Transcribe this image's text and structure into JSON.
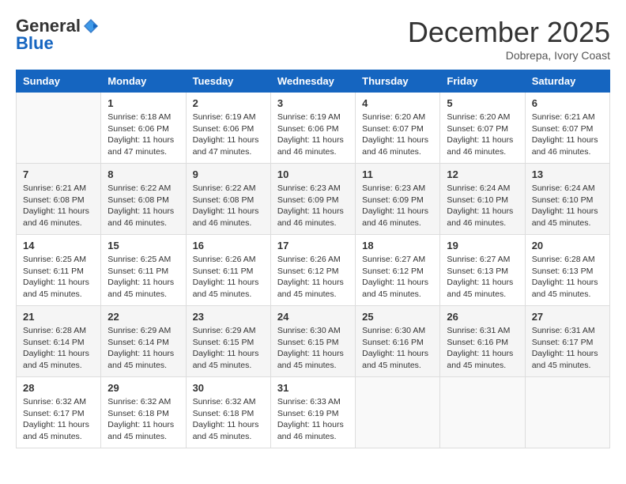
{
  "header": {
    "logo_general": "General",
    "logo_blue": "Blue",
    "month_title": "December 2025",
    "location": "Dobrepa, Ivory Coast"
  },
  "days_of_week": [
    "Sunday",
    "Monday",
    "Tuesday",
    "Wednesday",
    "Thursday",
    "Friday",
    "Saturday"
  ],
  "weeks": [
    [
      {
        "day": "",
        "info": ""
      },
      {
        "day": "1",
        "info": "Sunrise: 6:18 AM\nSunset: 6:06 PM\nDaylight: 11 hours and 47 minutes."
      },
      {
        "day": "2",
        "info": "Sunrise: 6:19 AM\nSunset: 6:06 PM\nDaylight: 11 hours and 47 minutes."
      },
      {
        "day": "3",
        "info": "Sunrise: 6:19 AM\nSunset: 6:06 PM\nDaylight: 11 hours and 46 minutes."
      },
      {
        "day": "4",
        "info": "Sunrise: 6:20 AM\nSunset: 6:07 PM\nDaylight: 11 hours and 46 minutes."
      },
      {
        "day": "5",
        "info": "Sunrise: 6:20 AM\nSunset: 6:07 PM\nDaylight: 11 hours and 46 minutes."
      },
      {
        "day": "6",
        "info": "Sunrise: 6:21 AM\nSunset: 6:07 PM\nDaylight: 11 hours and 46 minutes."
      }
    ],
    [
      {
        "day": "7",
        "info": "Sunrise: 6:21 AM\nSunset: 6:08 PM\nDaylight: 11 hours and 46 minutes."
      },
      {
        "day": "8",
        "info": "Sunrise: 6:22 AM\nSunset: 6:08 PM\nDaylight: 11 hours and 46 minutes."
      },
      {
        "day": "9",
        "info": "Sunrise: 6:22 AM\nSunset: 6:08 PM\nDaylight: 11 hours and 46 minutes."
      },
      {
        "day": "10",
        "info": "Sunrise: 6:23 AM\nSunset: 6:09 PM\nDaylight: 11 hours and 46 minutes."
      },
      {
        "day": "11",
        "info": "Sunrise: 6:23 AM\nSunset: 6:09 PM\nDaylight: 11 hours and 46 minutes."
      },
      {
        "day": "12",
        "info": "Sunrise: 6:24 AM\nSunset: 6:10 PM\nDaylight: 11 hours and 46 minutes."
      },
      {
        "day": "13",
        "info": "Sunrise: 6:24 AM\nSunset: 6:10 PM\nDaylight: 11 hours and 45 minutes."
      }
    ],
    [
      {
        "day": "14",
        "info": "Sunrise: 6:25 AM\nSunset: 6:11 PM\nDaylight: 11 hours and 45 minutes."
      },
      {
        "day": "15",
        "info": "Sunrise: 6:25 AM\nSunset: 6:11 PM\nDaylight: 11 hours and 45 minutes."
      },
      {
        "day": "16",
        "info": "Sunrise: 6:26 AM\nSunset: 6:11 PM\nDaylight: 11 hours and 45 minutes."
      },
      {
        "day": "17",
        "info": "Sunrise: 6:26 AM\nSunset: 6:12 PM\nDaylight: 11 hours and 45 minutes."
      },
      {
        "day": "18",
        "info": "Sunrise: 6:27 AM\nSunset: 6:12 PM\nDaylight: 11 hours and 45 minutes."
      },
      {
        "day": "19",
        "info": "Sunrise: 6:27 AM\nSunset: 6:13 PM\nDaylight: 11 hours and 45 minutes."
      },
      {
        "day": "20",
        "info": "Sunrise: 6:28 AM\nSunset: 6:13 PM\nDaylight: 11 hours and 45 minutes."
      }
    ],
    [
      {
        "day": "21",
        "info": "Sunrise: 6:28 AM\nSunset: 6:14 PM\nDaylight: 11 hours and 45 minutes."
      },
      {
        "day": "22",
        "info": "Sunrise: 6:29 AM\nSunset: 6:14 PM\nDaylight: 11 hours and 45 minutes."
      },
      {
        "day": "23",
        "info": "Sunrise: 6:29 AM\nSunset: 6:15 PM\nDaylight: 11 hours and 45 minutes."
      },
      {
        "day": "24",
        "info": "Sunrise: 6:30 AM\nSunset: 6:15 PM\nDaylight: 11 hours and 45 minutes."
      },
      {
        "day": "25",
        "info": "Sunrise: 6:30 AM\nSunset: 6:16 PM\nDaylight: 11 hours and 45 minutes."
      },
      {
        "day": "26",
        "info": "Sunrise: 6:31 AM\nSunset: 6:16 PM\nDaylight: 11 hours and 45 minutes."
      },
      {
        "day": "27",
        "info": "Sunrise: 6:31 AM\nSunset: 6:17 PM\nDaylight: 11 hours and 45 minutes."
      }
    ],
    [
      {
        "day": "28",
        "info": "Sunrise: 6:32 AM\nSunset: 6:17 PM\nDaylight: 11 hours and 45 minutes."
      },
      {
        "day": "29",
        "info": "Sunrise: 6:32 AM\nSunset: 6:18 PM\nDaylight: 11 hours and 45 minutes."
      },
      {
        "day": "30",
        "info": "Sunrise: 6:32 AM\nSunset: 6:18 PM\nDaylight: 11 hours and 45 minutes."
      },
      {
        "day": "31",
        "info": "Sunrise: 6:33 AM\nSunset: 6:19 PM\nDaylight: 11 hours and 46 minutes."
      },
      {
        "day": "",
        "info": ""
      },
      {
        "day": "",
        "info": ""
      },
      {
        "day": "",
        "info": ""
      }
    ]
  ]
}
